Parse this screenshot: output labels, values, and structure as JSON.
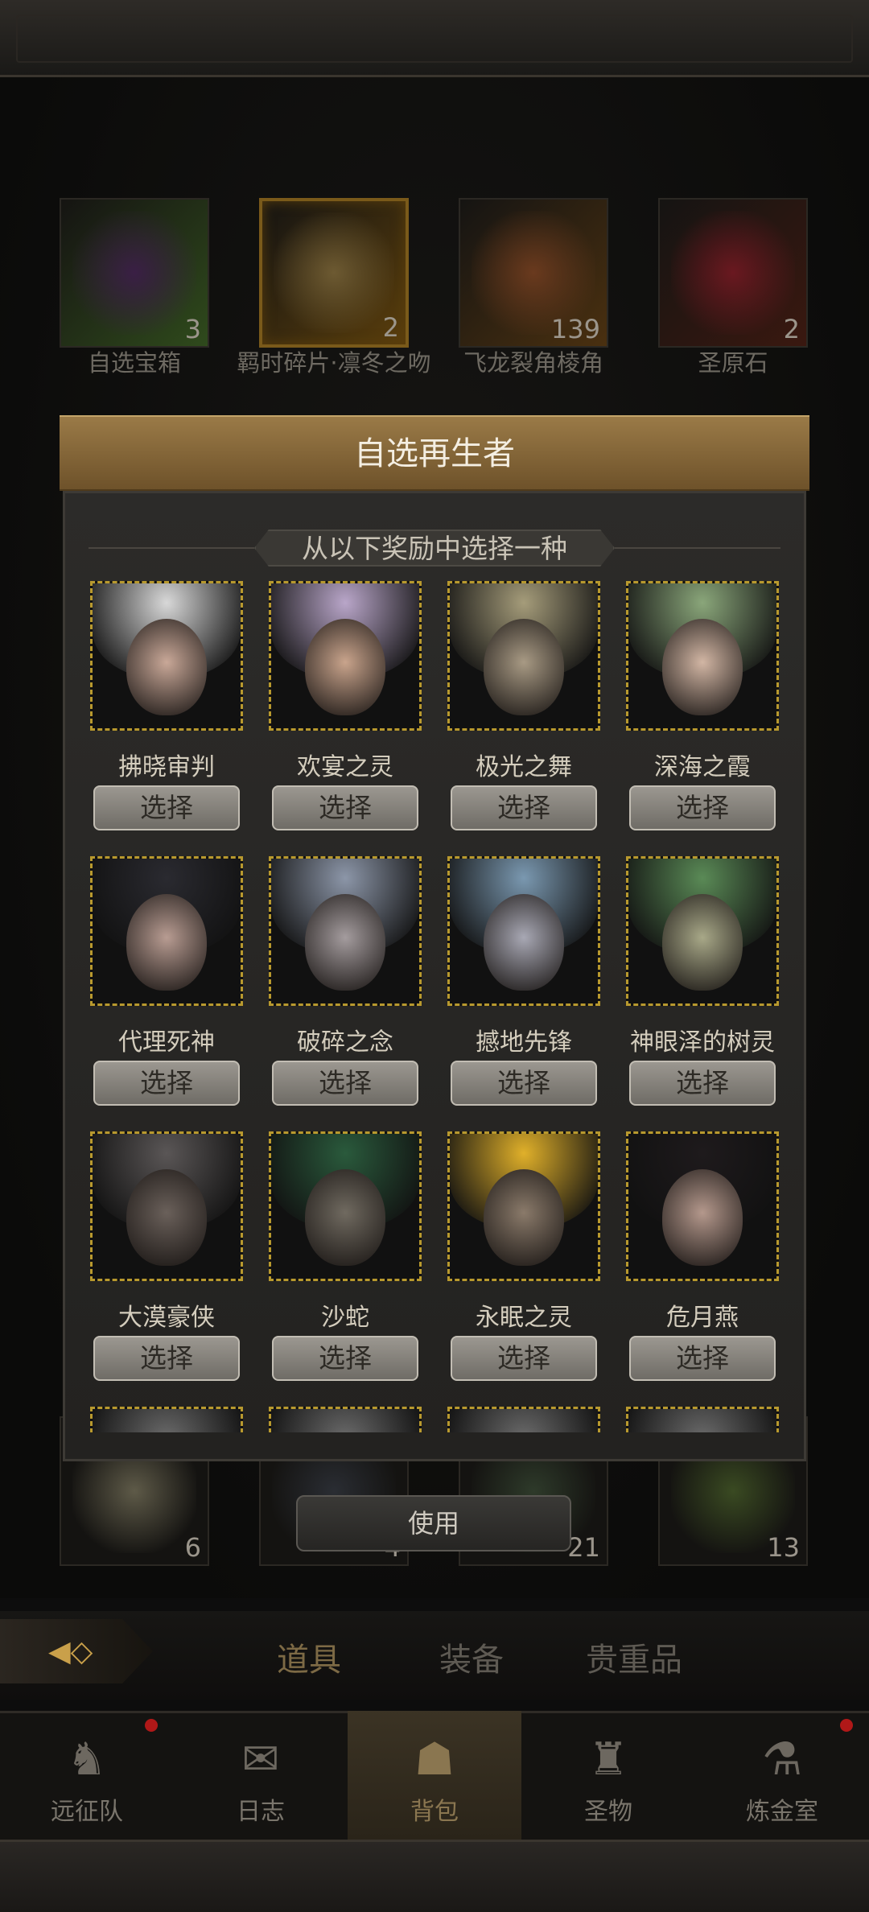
{
  "background_items_top": [
    {
      "name": "自选宝箱",
      "count": "3",
      "art_color": "#3a1f45",
      "rarity": "#2f4a1c"
    },
    {
      "name": "羁时碎片·凛冬之吻",
      "count": "2",
      "art_color": "#6d5a32",
      "rarity": "#5a3e0c"
    },
    {
      "name": "飞龙裂角棱角",
      "count": "139",
      "art_color": "#6a3a1e",
      "rarity": "#4a3010"
    },
    {
      "name": "圣原石",
      "count": "2",
      "art_color": "#6a1820",
      "rarity": "#3a1810"
    }
  ],
  "background_items_bottom": [
    {
      "count": "6",
      "art_color": "#5e5a48"
    },
    {
      "count": "4",
      "art_color": "#2a2d33"
    },
    {
      "count": "21",
      "art_color": "#2e3a2a"
    },
    {
      "count": "13",
      "art_color": "#3a4a22"
    }
  ],
  "use_button": "使用",
  "category_tabs": [
    "道具",
    "装备",
    "贵重品"
  ],
  "bottom_nav": [
    {
      "label": "远征队",
      "icon": "viking-helmet-icon",
      "glyph": "♞",
      "badge": true
    },
    {
      "label": "日志",
      "icon": "scroll-icon",
      "glyph": "✉",
      "badge": false
    },
    {
      "label": "背包",
      "icon": "backpack-icon",
      "glyph": "☗",
      "badge": false
    },
    {
      "label": "圣物",
      "icon": "chalice-icon",
      "glyph": "♜",
      "badge": false
    },
    {
      "label": "炼金室",
      "icon": "alchemy-icon",
      "glyph": "⚗",
      "badge": true
    }
  ],
  "modal": {
    "title": "自选再生者",
    "subtitle": "从以下奖励中选择一种",
    "select_label": "选择",
    "heroes": [
      {
        "name": "拂晓审判",
        "hair": "#d8d8d8",
        "skin": "#c9a898"
      },
      {
        "name": "欢宴之灵",
        "hair": "#b9a6c9",
        "skin": "#c9a48c"
      },
      {
        "name": "极光之舞",
        "hair": "#a59c7a",
        "skin": "#a89a84"
      },
      {
        "name": "深海之霞",
        "hair": "#8aa67a",
        "skin": "#d2b6a4"
      },
      {
        "name": "代理死神",
        "hair": "#2a2a30",
        "skin": "#b89c92"
      },
      {
        "name": "破碎之念",
        "hair": "#8c96a8",
        "skin": "#a49c9e"
      },
      {
        "name": "撼地先锋",
        "hair": "#7a98b0",
        "skin": "#a8a8b4"
      },
      {
        "name": "神眼泽的树灵",
        "hair": "#5a8a56",
        "skin": "#a8a888"
      },
      {
        "name": "大漠豪侠",
        "hair": "#5a5656",
        "skin": "#6a605a"
      },
      {
        "name": "沙蛇",
        "hair": "#2a5a3c",
        "skin": "#706a60"
      },
      {
        "name": "永眠之灵",
        "hair": "#e0b02a",
        "skin": "#8a7a6a"
      },
      {
        "name": "危月燕",
        "hair": "#1e1a1c",
        "skin": "#b4988c"
      }
    ]
  }
}
